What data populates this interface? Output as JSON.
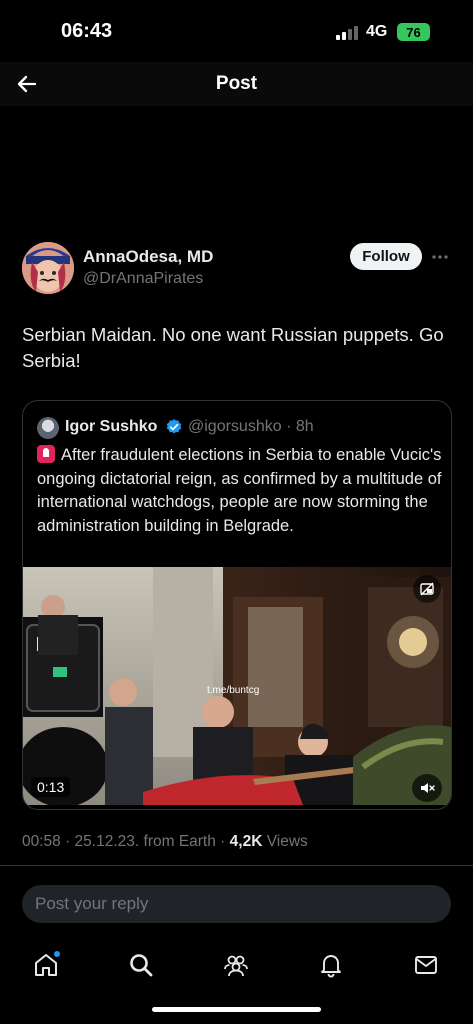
{
  "status_bar": {
    "time": "06:43",
    "network": "4G",
    "battery": "76"
  },
  "nav": {
    "title": "Post"
  },
  "author": {
    "name": "AnnaOdesa, MD",
    "handle": "@DrAnnaPirates",
    "follow_label": "Follow"
  },
  "tweet": {
    "text": "Serbian Maidan. No one want Russian puppets. Go Serbia!"
  },
  "quote": {
    "name": "Igor Sushko",
    "handle_time": "@igorsushko · 8h",
    "text": "After fraudulent elections in Serbia to enable Vucic's ongoing dictatorial reign, as confirmed by a multitude of international watchdogs, people are now storming the administration building in Belgrade.",
    "video": {
      "watermark": "t.me/buntcg",
      "duration": "0:13"
    }
  },
  "meta": {
    "timestamp": "00:58 · 25.12.23. from Earth ·",
    "views_count": "4,2K",
    "views_label": "Views"
  },
  "reply": {
    "placeholder": "Post your reply"
  },
  "icons": {
    "back": "arrow-left-icon",
    "more": "more-horizontal-icon",
    "verified": "verified-badge-icon",
    "siren": "siren-emoji-icon",
    "mute": "speaker-muted-icon",
    "pip": "picture-in-picture-off-icon",
    "tabs": [
      "home-icon",
      "search-icon",
      "communities-icon",
      "notifications-icon",
      "messages-icon"
    ]
  },
  "colors": {
    "accent": "#1d9bf0",
    "battery": "#34c759",
    "background": "#000000"
  }
}
